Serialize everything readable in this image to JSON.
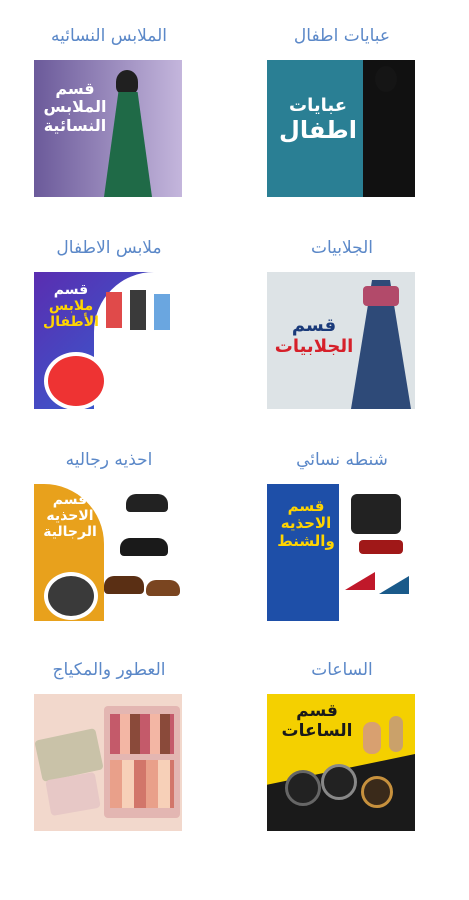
{
  "categories": [
    {
      "title": "عبايات اطفال",
      "banner_lines": [
        "عبايات",
        "اطفال"
      ],
      "icon": "kids-abaya-icon"
    },
    {
      "title": "الملابس النسائيه",
      "banner_lines": [
        "قسم",
        "الملابس",
        "النسائية"
      ],
      "icon": "womens-dress-icon"
    },
    {
      "title": "الجلابيات",
      "banner_lines": [
        "قسم",
        "الجلابيات"
      ],
      "icon": "jalabiya-icon"
    },
    {
      "title": "ملابس الاطفال",
      "banner_lines": [
        "قسم",
        "ملابس",
        "الأطفال"
      ],
      "icon": "kids-clothes-icon"
    },
    {
      "title": "شنطه نسائي",
      "banner_lines": [
        "قسم",
        "الاحذيه",
        "والشنط"
      ],
      "icon": "handbag-icon"
    },
    {
      "title": "احذيه رجاليه",
      "banner_lines": [
        "قسم",
        "الاحذيه",
        "الرجالية"
      ],
      "icon": "mens-shoes-icon"
    },
    {
      "title": "الساعات",
      "banner_lines": [
        "قسم",
        "الساعات"
      ],
      "icon": "watches-icon"
    },
    {
      "title": "العطور والمكياج",
      "banner_lines": [],
      "icon": "makeup-palette-icon"
    }
  ],
  "colors": {
    "title_text": "#5b88c8",
    "kids_abaya_bg": "#2a7f94",
    "womens_bg": "#a793c6",
    "jalabiya_bg": "#dde3e6",
    "kids_clothes_bg": "#2d3aa8",
    "bags_bg": "#1e4fa8",
    "mens_shoes_bg": "#e8a11c",
    "watches_bg": "#f4d000",
    "makeup_bg": "#f2d8cc"
  }
}
